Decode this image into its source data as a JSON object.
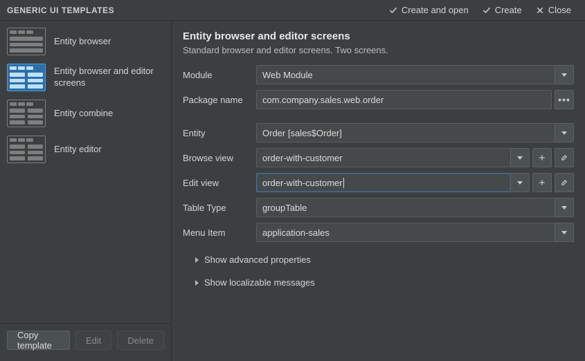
{
  "title": "GENERIC UI TEMPLATES",
  "titlebar": {
    "create_open": "Create and open",
    "create": "Create",
    "close": "Close"
  },
  "sidebar": {
    "items": [
      {
        "label": "Entity browser"
      },
      {
        "label": "Entity browser and editor screens"
      },
      {
        "label": "Entity combine"
      },
      {
        "label": "Entity editor"
      }
    ]
  },
  "main": {
    "heading": "Entity browser and editor screens",
    "description": "Standard browser and editor screens. Two screens.",
    "labels": {
      "module": "Module",
      "package": "Package name",
      "entity": "Entity",
      "browse_view": "Browse view",
      "edit_view": "Edit view",
      "table_type": "Table Type",
      "menu_item": "Menu Item"
    },
    "values": {
      "module": "Web Module",
      "package": "com.company.sales.web.order",
      "entity": "Order [sales$Order]",
      "browse_view": "order-with-customer",
      "edit_view": "order-with-customer",
      "table_type": "groupTable",
      "menu_item": "application-sales"
    },
    "advanced": "Show advanced properties",
    "localizable": "Show localizable messages"
  },
  "footer": {
    "copy": "Copy template",
    "edit": "Edit",
    "delete": "Delete"
  }
}
